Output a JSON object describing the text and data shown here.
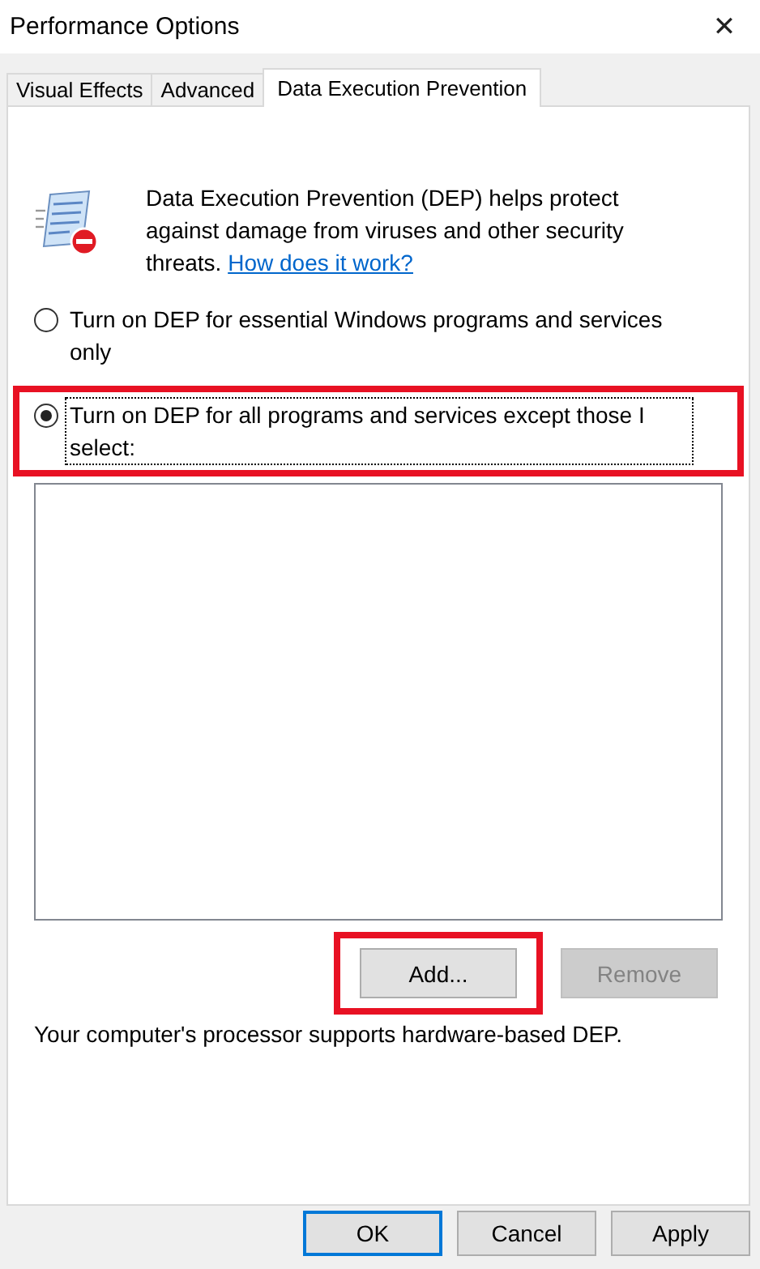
{
  "window": {
    "title": "Performance Options",
    "close": "✕"
  },
  "tabs": [
    {
      "label": "Visual Effects",
      "selected": false
    },
    {
      "label": "Advanced",
      "selected": false
    },
    {
      "label": "Data Execution Prevention",
      "selected": true
    }
  ],
  "intro": {
    "text": "Data Execution Prevention (DEP) helps protect against damage from viruses and other security threats.",
    "link": "How does it work?"
  },
  "options": [
    {
      "label": "Turn on DEP for essential Windows programs and services only",
      "selected": false,
      "highlighted": false
    },
    {
      "label": "Turn on DEP for all programs and services except those I select:",
      "selected": true,
      "highlighted": true
    }
  ],
  "list_buttons": [
    {
      "label": "Add...",
      "disabled": false,
      "highlighted": true
    },
    {
      "label": "Remove",
      "disabled": true,
      "highlighted": false
    }
  ],
  "status_text": "Your computer's processor supports hardware-based DEP.",
  "buttons": [
    {
      "label": "OK",
      "default": true
    },
    {
      "label": "Cancel",
      "default": false
    },
    {
      "label": "Apply",
      "default": false
    }
  ]
}
